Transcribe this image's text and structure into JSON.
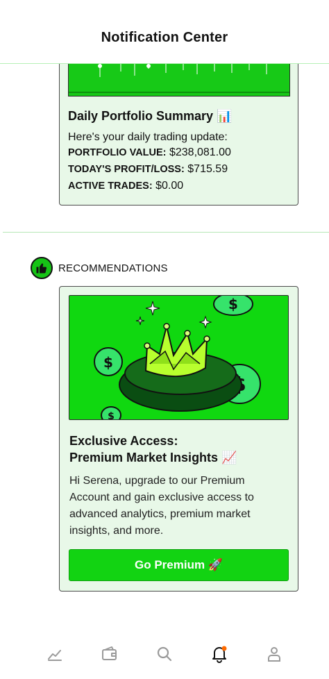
{
  "header": {
    "title": "Notification Center"
  },
  "portfolio_card": {
    "title": "Daily Portfolio Summary 📊",
    "intro": "Here's your daily trading update:",
    "rows": [
      {
        "label": "PORTFOLIO VALUE:",
        "value": "$238,081.00"
      },
      {
        "label": "TODAY'S PROFIT/LOSS:",
        "value": "$715.59"
      },
      {
        "label": "ACTIVE TRADES:",
        "value": "$0.00"
      }
    ]
  },
  "recommendations": {
    "section_label": "RECOMMENDATIONS",
    "card": {
      "title_line1": "Exclusive Access:",
      "title_line2": "Premium Market Insights 📈",
      "body": "Hi Serena, upgrade to our Premium Account and gain exclusive access to advanced analytics, premium market insights, and more.",
      "cta_label": "Go Premium 🚀"
    }
  },
  "bottom_nav": {
    "items": [
      {
        "icon": "chart-icon",
        "active": false
      },
      {
        "icon": "wallet-icon",
        "active": false
      },
      {
        "icon": "search-icon",
        "active": false
      },
      {
        "icon": "bell-icon",
        "active": true,
        "has_badge": true
      },
      {
        "icon": "user-icon",
        "active": false
      }
    ]
  },
  "colors": {
    "accent": "#12d312",
    "card_bg": "#e8f8e8",
    "badge": "#ff6a00"
  }
}
